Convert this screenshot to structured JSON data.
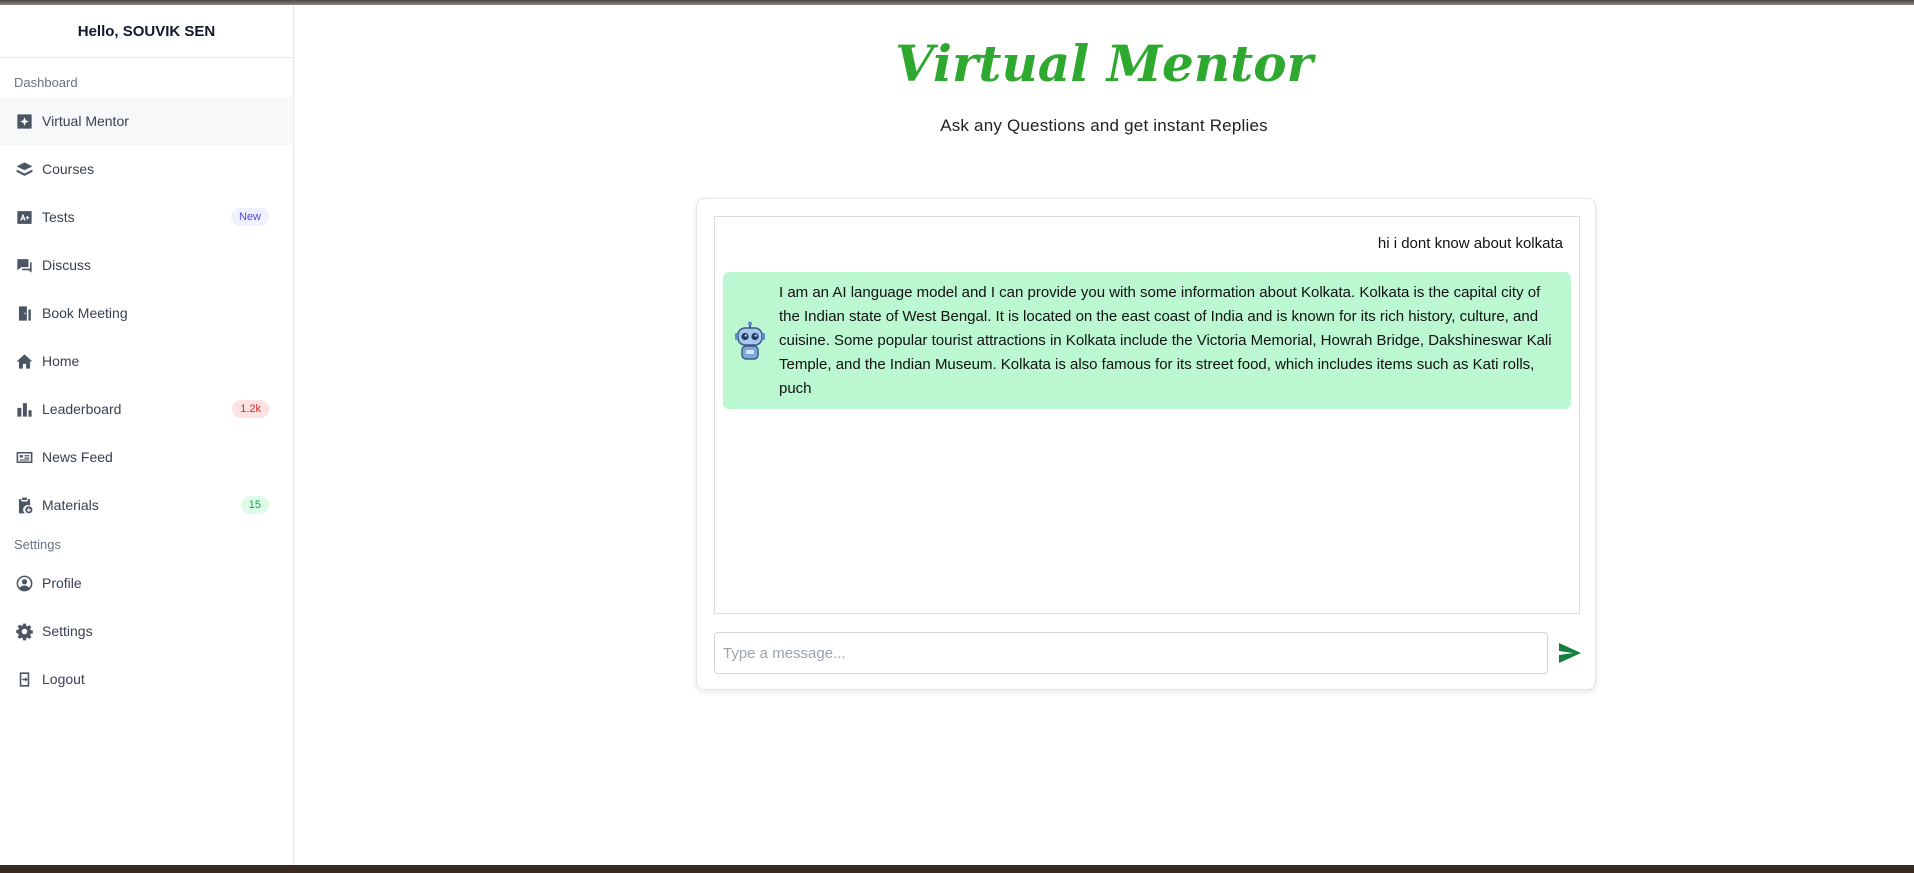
{
  "sidebar": {
    "greeting": "Hello, SOUVIK SEN",
    "sections": {
      "dashboard_label": "Dashboard",
      "settings_label": "Settings"
    },
    "items": [
      {
        "label": "Virtual Mentor",
        "icon": "sparkle-icon"
      },
      {
        "label": "Courses",
        "icon": "layers-icon"
      },
      {
        "label": "Tests",
        "icon": "grade-icon",
        "badge": "New"
      },
      {
        "label": "Discuss",
        "icon": "chat-icon"
      },
      {
        "label": "Book Meeting",
        "icon": "door-icon"
      },
      {
        "label": "Home",
        "icon": "home-icon"
      },
      {
        "label": "Leaderboard",
        "icon": "bar-chart-icon",
        "badge": "1.2k"
      },
      {
        "label": "News Feed",
        "icon": "newspaper-icon"
      },
      {
        "label": "Materials",
        "icon": "clipboard-icon",
        "badge": "15"
      },
      {
        "label": "Profile",
        "icon": "user-circle-icon"
      },
      {
        "label": "Settings",
        "icon": "gear-icon"
      },
      {
        "label": "Logout",
        "icon": "logout-icon"
      }
    ]
  },
  "header": {
    "title": "Virtual Mentor",
    "subtitle": "Ask any Questions and get instant Replies"
  },
  "chat": {
    "user_message": "hi i dont know about kolkata",
    "bot_message": "I am an AI language model and I can provide you with some information about Kolkata. Kolkata is the capital city of the Indian state of West Bengal. It is located on the east coast of India and is known for its rich history, culture, and cuisine. Some popular tourist attractions in Kolkata include the Victoria Memorial, Howrah Bridge, Dakshineswar Kali Temple, and the Indian Museum. Kolkata is also famous for its street food, which includes items such as Kati rolls, puch",
    "input_placeholder": "Type a message...",
    "input_value": ""
  },
  "colors": {
    "title": "#2ea82e",
    "bot_bubble": "#bbf7d0",
    "send_icon": "#15803d"
  }
}
